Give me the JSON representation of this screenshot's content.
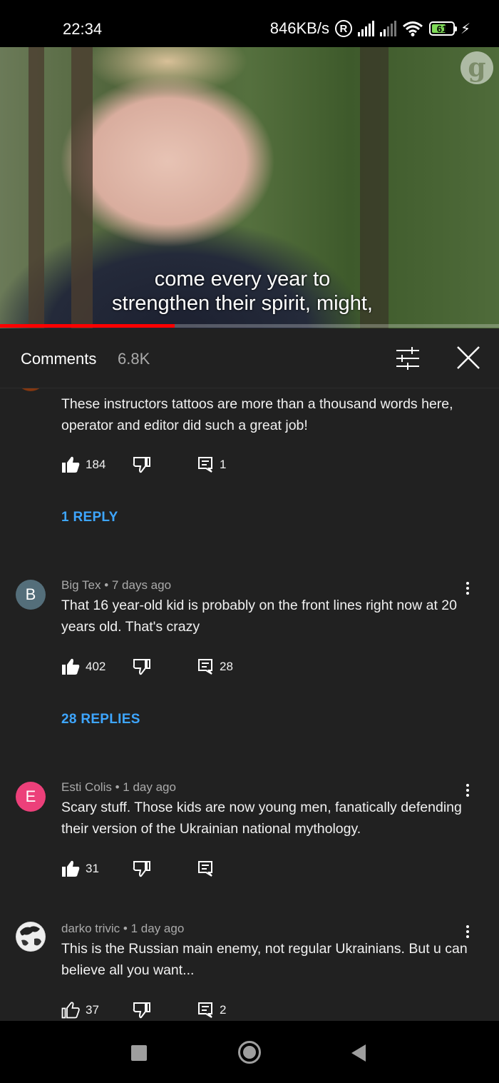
{
  "status_bar": {
    "time": "22:34",
    "network_speed": "846KB/s",
    "roaming": "R",
    "battery_level": "61",
    "battery_color": "#7ed957"
  },
  "video": {
    "subtitle_line1": "come every year to",
    "subtitle_line2": "strengthen their spirit, might,",
    "watermark_icon": "guardian-g-logo",
    "progress_fraction": 0.35,
    "progress_color": "#ff0000"
  },
  "comments_panel": {
    "title": "Comments",
    "count": "6.8K",
    "filter_icon": "sliders-icon",
    "close_icon": "close-icon",
    "comments": [
      {
        "author": "",
        "time": "",
        "avatar_letter": "",
        "avatar_color": "#8a3a10",
        "text": "These instructors tattoos are more than a thousand words here, operator and editor did such a great job!",
        "likes": "184",
        "reply_count": "1",
        "liked": true,
        "replies_link": "1 REPLY"
      },
      {
        "author": "Big Tex",
        "time": "7 days ago",
        "avatar_letter": "B",
        "avatar_color": "#546e7a",
        "text": "That 16 year-old kid is probably on the front lines right now at 20 years old. That's crazy",
        "likes": "402",
        "reply_count": "28",
        "liked": true,
        "replies_link": "28 REPLIES"
      },
      {
        "author": "Esti Colis",
        "time": "1 day ago",
        "avatar_letter": "E",
        "avatar_color": "#ec407a",
        "text": "Scary stuff. Those kids are now young men, fanatically defending their version of the Ukrainian national mythology.",
        "likes": "31",
        "reply_count": "",
        "liked": true,
        "replies_link": ""
      },
      {
        "author": "darko trivic",
        "time": "1 day ago",
        "avatar_letter": "",
        "avatar_color": "#ffffff",
        "text": "This is the Russian main enemy, not regular Ukrainians. But u can believe all you want...",
        "likes": "37",
        "reply_count": "2",
        "liked": false,
        "replies_link": ""
      }
    ]
  },
  "nav_bar": {
    "recents_icon": "square-recents-icon",
    "home_icon": "circle-home-icon",
    "back_icon": "triangle-back-icon"
  }
}
